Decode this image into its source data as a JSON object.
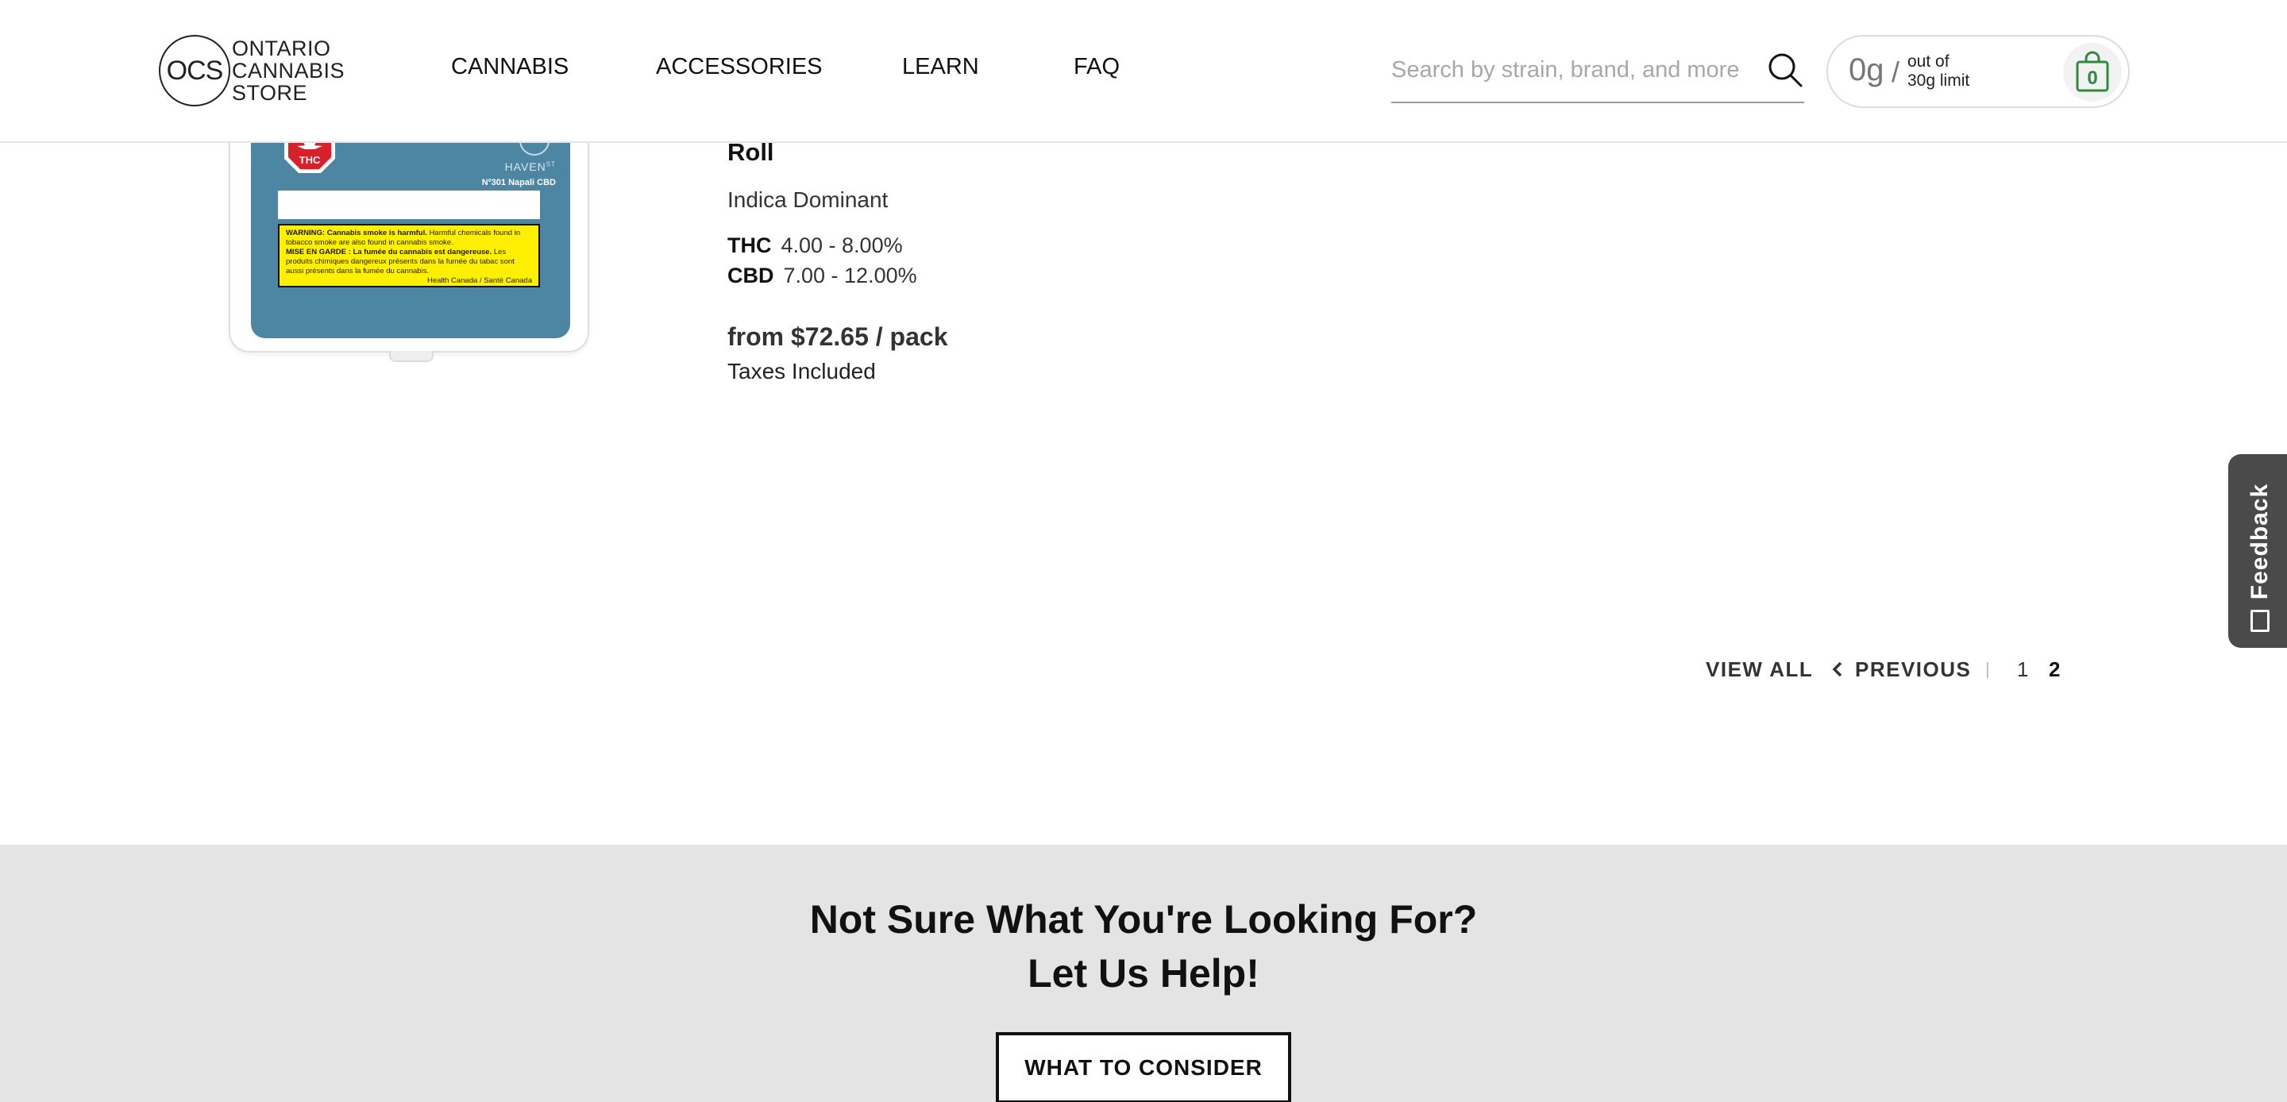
{
  "header": {
    "logo": {
      "mark": "OCS",
      "line1": "ONTARIO",
      "line2": "CANNABIS",
      "line3": "STORE"
    },
    "nav": [
      {
        "label": "CANNABIS"
      },
      {
        "label": "ACCESSORIES"
      },
      {
        "label": "LEARN"
      },
      {
        "label": "FAQ"
      }
    ],
    "search": {
      "placeholder": "Search by strain, brand, and more",
      "icon": "search-icon"
    },
    "cart": {
      "amount": "0g",
      "slash": "/",
      "limit_line1": "out of",
      "limit_line2": "30g limit",
      "count": "0",
      "icon": "shopping-bag-icon",
      "accent": "#2e8b3e"
    }
  },
  "product": {
    "image_label": {
      "badge": "THC",
      "brand": "HAVEN",
      "brand_suffix": "ST",
      "name": "Nº301 Napali CBD",
      "warning_en_bold": "WARNING: Cannabis smoke is harmful.",
      "warning_en": " Harmful chemicals found in tobacco smoke are also found in cannabis smoke.",
      "warning_fr_bold": "MISE EN GARDE : La fumée du cannabis est dangereuse.",
      "warning_fr": " Les produits chimiques dangereux présents dans la fumée du tabac sont aussi présents dans la fumée du cannabis.",
      "warning_source": "Health Canada / Santé Canada"
    },
    "title": "Roll",
    "dominance": "Indica Dominant",
    "thc_label": "THC",
    "thc_value": "4.00 - 8.00%",
    "cbd_label": "CBD",
    "cbd_value": "7.00 - 12.00%",
    "price": "from $72.65 / pack",
    "tax_note": "Taxes Included"
  },
  "feedback": {
    "label": "Feedback",
    "icon": "feedback-icon",
    "color": "#4a4a4a"
  },
  "pagination": {
    "view_all": "VIEW ALL",
    "previous": "PREVIOUS",
    "separator": "|",
    "pages": [
      "1",
      "2"
    ],
    "current": "2"
  },
  "help": {
    "title_line1": "Not Sure What You're Looking For?",
    "title_line2": "Let Us Help!",
    "button": "WHAT TO CONSIDER",
    "background": "#e4e4e4"
  }
}
